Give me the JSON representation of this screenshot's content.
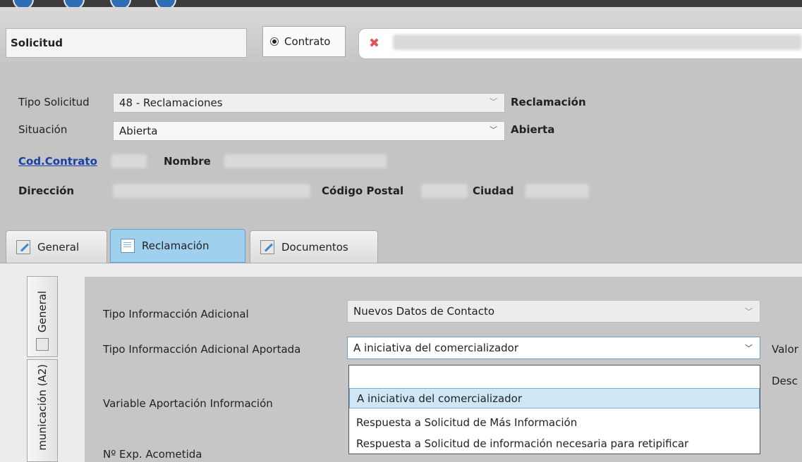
{
  "header": {
    "solicitud_label": "Solicitud",
    "contrato_option": "Contrato"
  },
  "form": {
    "tipo_solicitud_label": "Tipo Solicitud",
    "tipo_solicitud_value": "48 - Reclamaciones",
    "tipo_solicitud_desc": "Reclamación",
    "situacion_label": "Situación",
    "situacion_value": "Abierta",
    "situacion_desc": "Abierta",
    "cod_contrato_label": "Cod.Contrato",
    "nombre_label": "Nombre",
    "direccion_label": "Dirección",
    "codigo_postal_label": "Código Postal",
    "ciudad_label": "Ciudad"
  },
  "tabs": [
    {
      "label": "General"
    },
    {
      "label": "Reclamación"
    },
    {
      "label": "Documentos"
    }
  ],
  "side_tabs": [
    {
      "label": "General"
    },
    {
      "label": "municación (A2)"
    }
  ],
  "fields": {
    "tipo_info_label": "Tipo Informacción Adicional",
    "tipo_info_value": "Nuevos Datos de Contacto",
    "tipo_info_aportada_label": "Tipo Informacción Adicional Aportada",
    "tipo_info_aportada_value": "A iniciativa del comercializador",
    "variable_label": "Variable Aportación Información",
    "exp_label": "Nº Exp. Acometida",
    "valor_label": "Valor",
    "desc_label": "Desc"
  },
  "dropdown": {
    "options": [
      "",
      "A iniciativa del comercializador",
      "Respuesta a Solicitud de Más Información",
      "Respuesta a Solicitud de información necesaria para retipificar"
    ],
    "selected_index": 1
  },
  "colors": {
    "active_tab": "#9fd1ee",
    "link": "#1a3ea8",
    "close_x": "#e0525a"
  }
}
